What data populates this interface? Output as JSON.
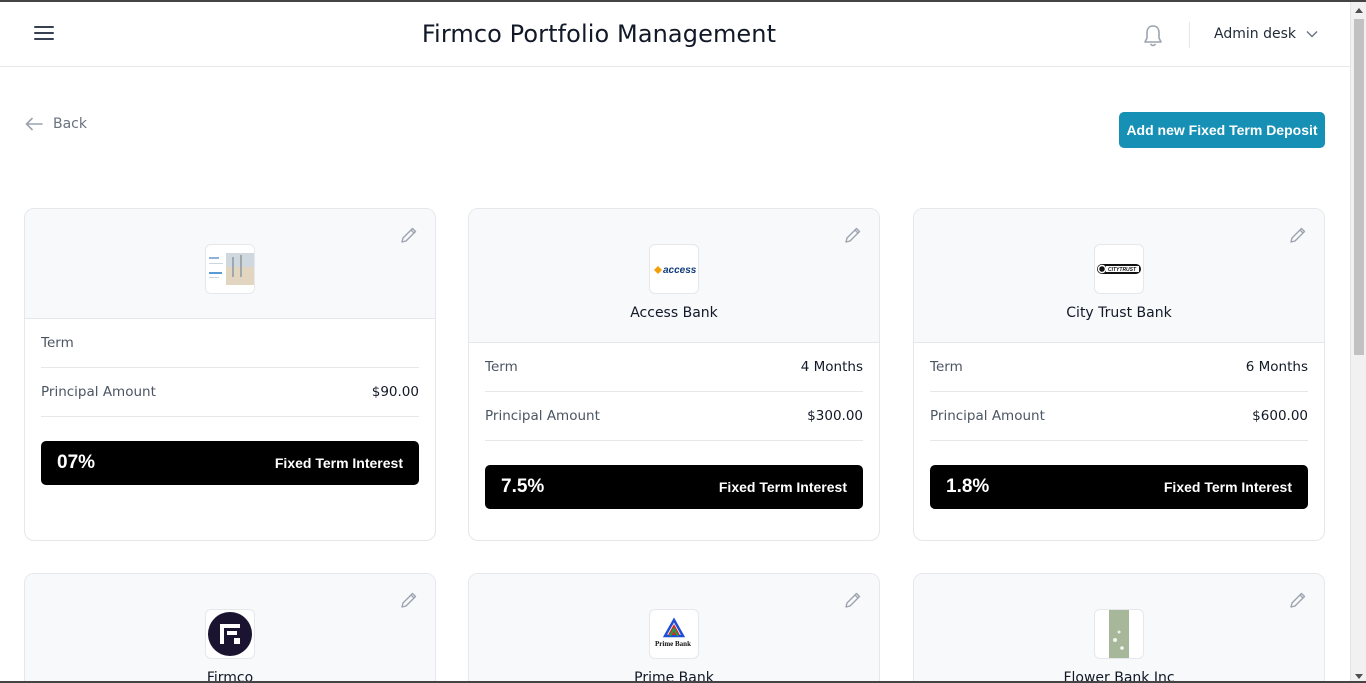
{
  "header": {
    "title": "Firmco Portfolio Management",
    "user": "Admin desk"
  },
  "nav": {
    "back_label": "Back",
    "add_button": "Add new Fixed Term Deposit"
  },
  "cards": [
    {
      "bank_name": "",
      "logo": "image-placeholder",
      "term_label": "Term",
      "term_value": "",
      "principal_label": "Principal Amount",
      "principal_value": "$90.00",
      "rate": "07%",
      "interest_label": "Fixed Term Interest"
    },
    {
      "bank_name": "Access Bank",
      "logo": "access-logo",
      "logo_text": "access",
      "term_label": "Term",
      "term_value": "4 Months",
      "principal_label": "Principal Amount",
      "principal_value": "$300.00",
      "rate": "7.5%",
      "interest_label": "Fixed Term Interest"
    },
    {
      "bank_name": "City Trust Bank",
      "logo": "city-trust-logo",
      "logo_text": "CITYTRUST",
      "term_label": "Term",
      "term_value": "6 Months",
      "principal_label": "Principal Amount",
      "principal_value": "$600.00",
      "rate": "1.8%",
      "interest_label": "Fixed Term Interest"
    },
    {
      "bank_name": "Firmco",
      "logo": "firmco-logo"
    },
    {
      "bank_name": "Prime Bank",
      "logo": "prime-bank-logo",
      "logo_text": "Prime Bank"
    },
    {
      "bank_name": "Flower Bank Inc",
      "logo": "flower-logo"
    }
  ],
  "colors": {
    "accent": "#1690b4",
    "interest_bg": "#000000",
    "card_header_bg": "#f8f9fb"
  }
}
